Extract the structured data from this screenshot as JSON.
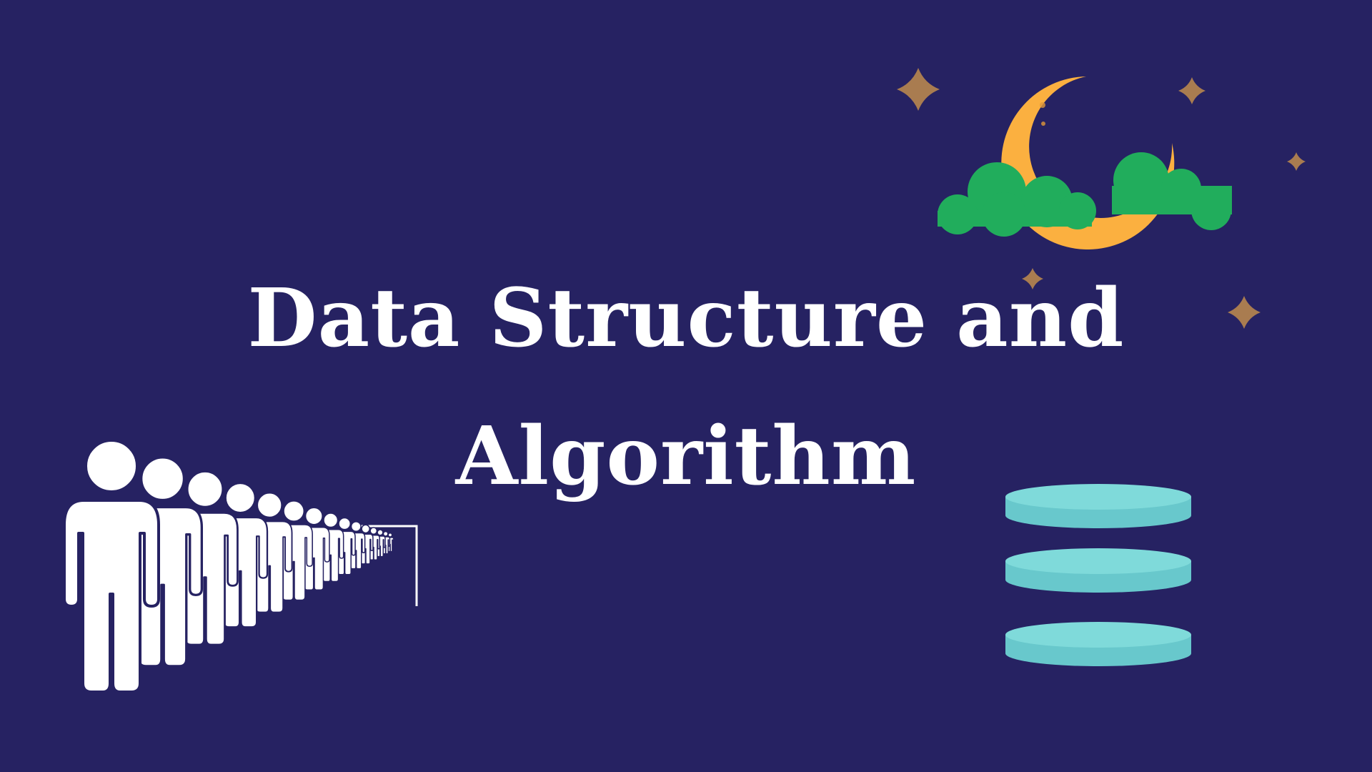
{
  "colors": {
    "background": "#262262",
    "title_text": "#ffffff",
    "moon": "#fbb040",
    "moon_spots": "#e0993a",
    "cloud": "#21ad5c",
    "star": "#a97c50",
    "person": "#ffffff",
    "database_top": "#7fdada",
    "database_side": "#68c8cc"
  },
  "title": {
    "line1": "Data Structure and",
    "line2": "Algorithm"
  },
  "icons": {
    "night_scene": "moon-clouds-stars",
    "queue": "people-queue",
    "database": "database-stack"
  },
  "queue": {
    "person_count": 15
  }
}
